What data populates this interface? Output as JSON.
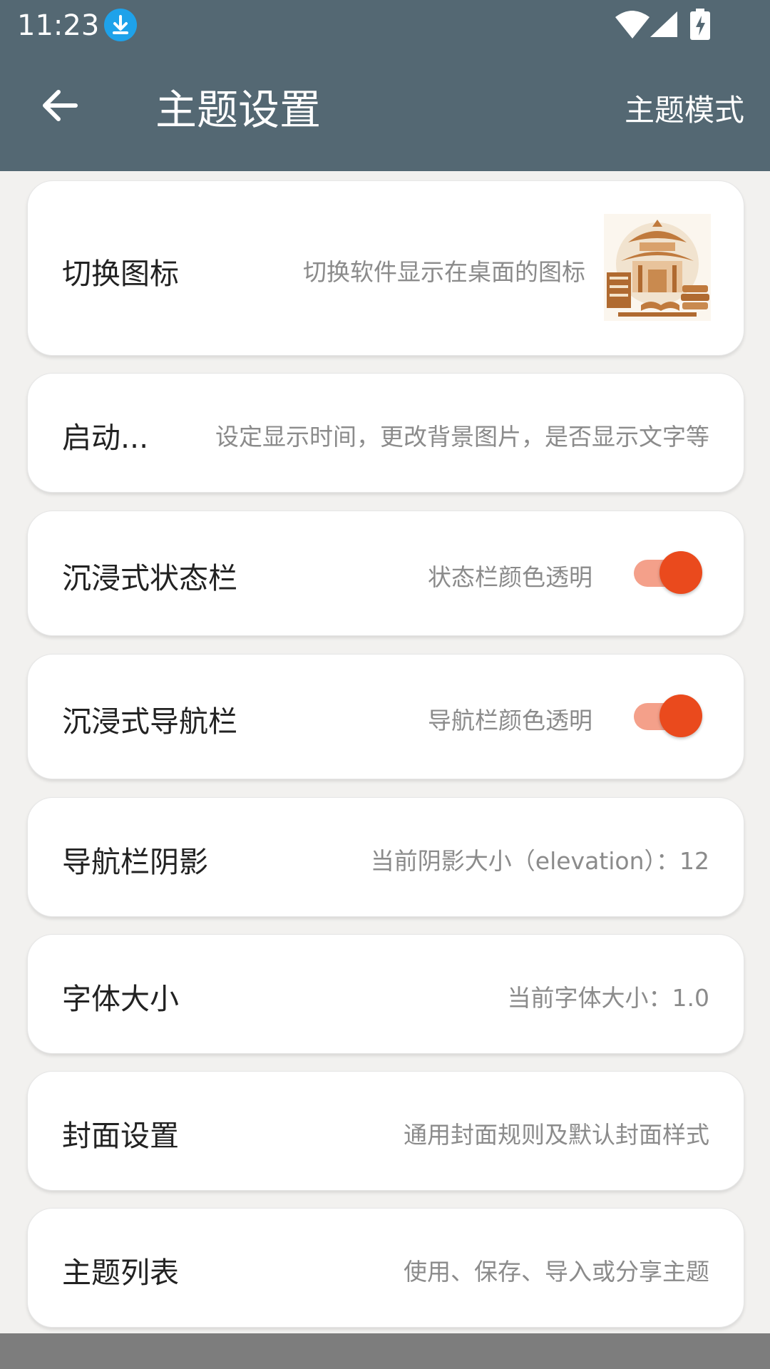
{
  "status_bar": {
    "time": "11:23",
    "icons": [
      "download-icon",
      "wifi-icon",
      "cell-signal-icon",
      "battery-charging-icon"
    ]
  },
  "app_bar": {
    "back_icon": "arrow-left-icon",
    "title": "主题设置",
    "action": "主题模式"
  },
  "settings": [
    {
      "title": "切换图标",
      "subtitle": "切换软件显示在桌面的图标",
      "trailing": "app-icon-thumbnail"
    },
    {
      "title": "启动...",
      "subtitle": "设定显示时间，更改背景图片，是否显示文字等"
    },
    {
      "title": "沉浸式状态栏",
      "subtitle": "状态栏颜色透明",
      "toggle_on": true
    },
    {
      "title": "沉浸式导航栏",
      "subtitle": "导航栏颜色透明",
      "toggle_on": true
    },
    {
      "title": "导航栏阴影",
      "subtitle": "当前阴影大小（elevation）：12"
    },
    {
      "title": "字体大小",
      "subtitle": "当前字体大小：1.0"
    },
    {
      "title": "封面设置",
      "subtitle": "通用封面规则及默认封面样式"
    },
    {
      "title": "主题列表",
      "subtitle": "使用、保存、导入或分享主题"
    }
  ],
  "colors": {
    "app_bar": "#546873",
    "background": "#f2f1ef",
    "toggle_accent": "#ea4a1d",
    "toggle_track": "#f4a08a",
    "download_badge": "#1ea2ea"
  }
}
